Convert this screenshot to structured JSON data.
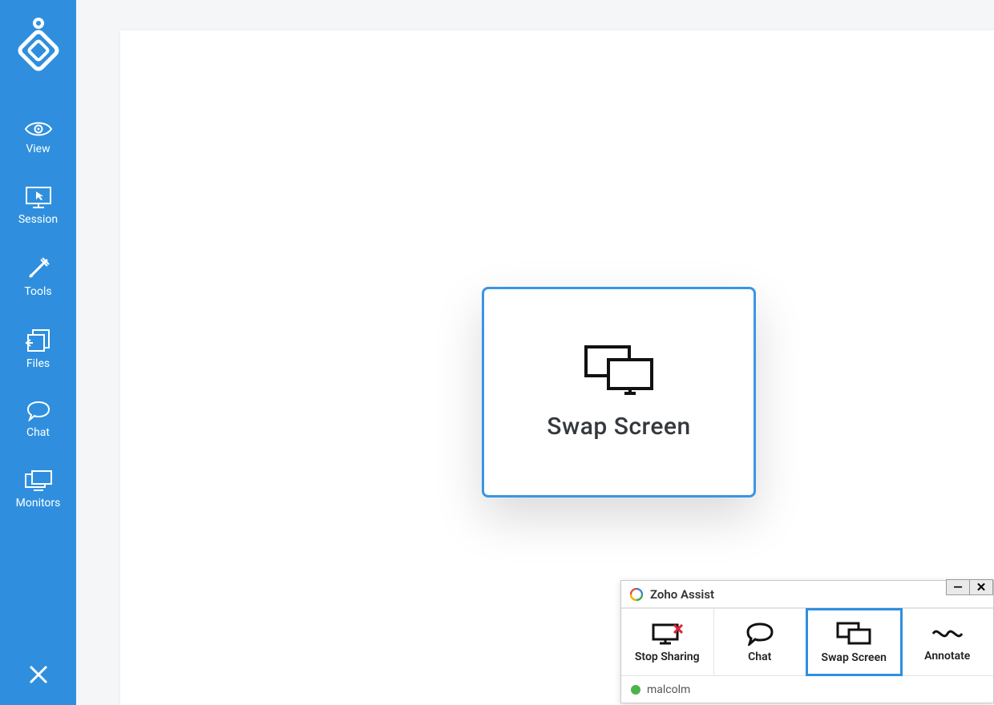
{
  "sidebar": {
    "items": [
      {
        "label": "View"
      },
      {
        "label": "Session"
      },
      {
        "label": "Tools"
      },
      {
        "label": "Files"
      },
      {
        "label": "Chat"
      },
      {
        "label": "Monitors"
      }
    ]
  },
  "swap_card": {
    "title": "Swap Screen"
  },
  "panel": {
    "title": "Zoho Assist",
    "controls": {
      "minimize": "—",
      "close": "✕"
    },
    "tabs": [
      {
        "label": "Stop Sharing"
      },
      {
        "label": "Chat"
      },
      {
        "label": "Swap Screen"
      },
      {
        "label": "Annotate"
      }
    ],
    "active_tab_index": 2,
    "status": {
      "user": "malcolm"
    }
  }
}
